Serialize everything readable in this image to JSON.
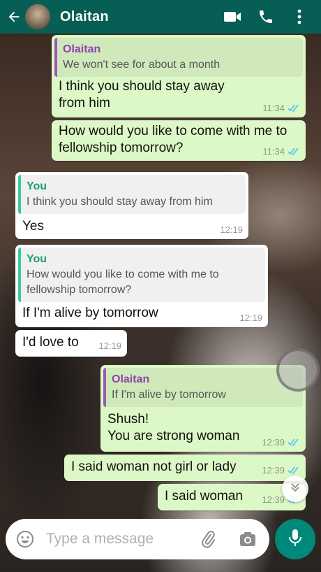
{
  "header": {
    "contact_name": "Olaitan",
    "icons": [
      "back-arrow-icon",
      "video-call-icon",
      "voice-call-icon",
      "more-options-icon"
    ]
  },
  "messages": [
    {
      "direction": "outgoing",
      "quote_author": "Olaitan",
      "quote_text": "We won't see for about a month",
      "text": "I think you should stay away from him",
      "time": "11:34",
      "status": "read"
    },
    {
      "direction": "outgoing",
      "text": "How would you like to come with me to fellowship tomorrow?",
      "time": "11:34",
      "status": "read"
    },
    {
      "direction": "incoming",
      "quote_author": "You",
      "quote_text": "I think you should stay away from him",
      "text": "Yes",
      "time": "12:19"
    },
    {
      "direction": "incoming",
      "quote_author": "You",
      "quote_text": "How would you like to come with me to fellowship tomorrow?",
      "text": "If I'm alive by tomorrow",
      "time": "12:19"
    },
    {
      "direction": "incoming",
      "text": "I'd love to",
      "time": "12:19"
    },
    {
      "direction": "outgoing",
      "quote_author": "Olaitan",
      "quote_text": "If I'm alive by tomorrow",
      "text": "Shush!\nYou are strong woman",
      "time": "12:39",
      "status": "read"
    },
    {
      "direction": "outgoing",
      "text": "I said woman not girl or lady",
      "time": "12:39",
      "status": "read"
    },
    {
      "direction": "outgoing",
      "text": "I said woman",
      "time": "12:39",
      "status": "read"
    }
  ],
  "composer": {
    "placeholder": "Type a message",
    "icons": [
      "emoji-icon",
      "attach-icon",
      "camera-icon",
      "mic-icon"
    ]
  },
  "colors": {
    "header": "#075e54",
    "outgoing_bubble": "#dcf8c6",
    "incoming_bubble": "#ffffff",
    "read_tick": "#4fc3f7",
    "mic_button": "#00897b"
  }
}
